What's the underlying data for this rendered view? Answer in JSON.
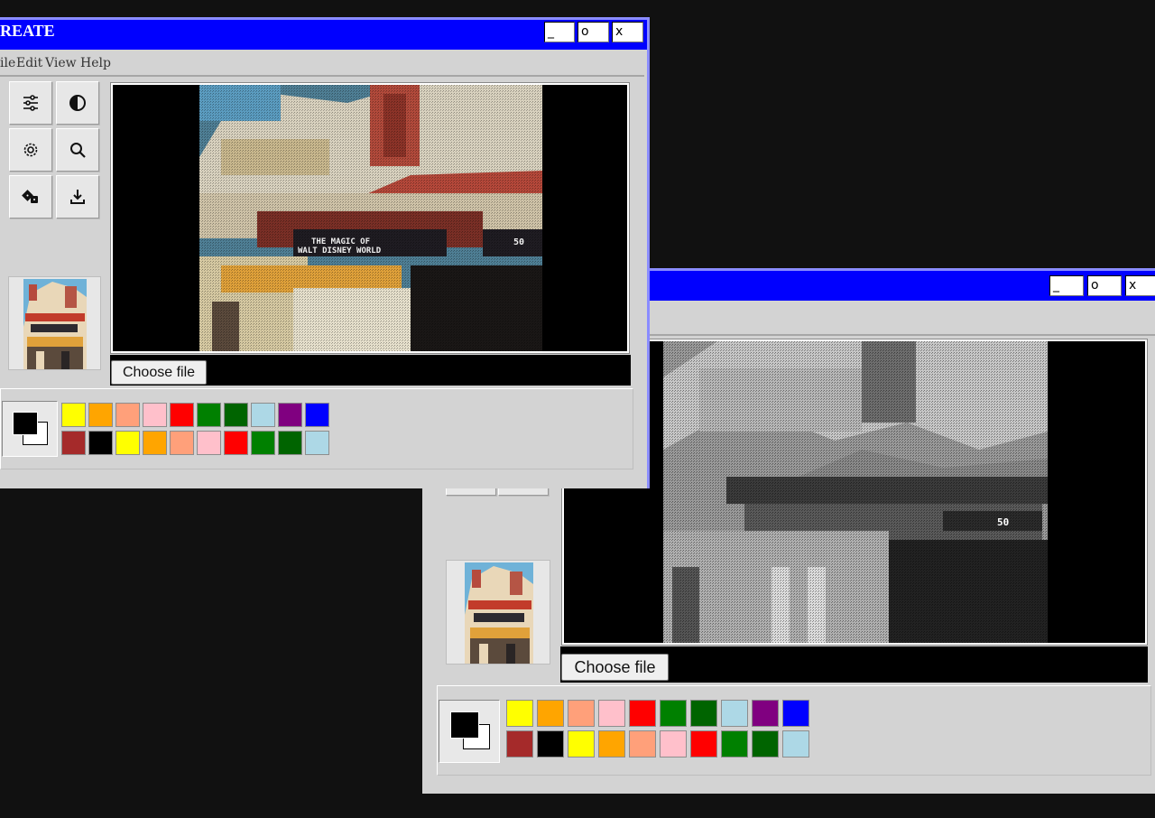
{
  "window1": {
    "title": "REATE",
    "controls": {
      "minimize": "_",
      "maximize": "o",
      "close": "x"
    },
    "menu": [
      "ile",
      "Edit",
      "View",
      "Help"
    ],
    "tools": [
      "sliders-icon",
      "contrast-icon",
      "gear-icon",
      "search-icon",
      "dice-icon",
      "download-icon"
    ],
    "choose_file": "Choose file",
    "image_text": {
      "sign_line1": "THE MAGIC OF",
      "sign_line2": "WALT DISNEY WORLD",
      "price": "50"
    }
  },
  "window2": {
    "controls": {
      "minimize": "_",
      "maximize": "o",
      "close": "x"
    },
    "choose_file": "Choose file",
    "image_text": {
      "price": "50"
    }
  },
  "palette": {
    "row1": [
      "#ffff00",
      "#ffa500",
      "#ffa07a",
      "#ffc0cb",
      "#ff0000",
      "#008000",
      "#006400",
      "#add8e6",
      "#800080",
      "#0000ff"
    ],
    "row2": [
      "#a52a2a",
      "#000000",
      "#ffff00",
      "#ffa500",
      "#ffa07a",
      "#ffc0cb",
      "#ff0000",
      "#008000",
      "#006400",
      "#add8e6"
    ]
  },
  "colors": {
    "desktop": "#111111",
    "titlebar": "#0000ff",
    "window_face": "#d3d3d3"
  }
}
